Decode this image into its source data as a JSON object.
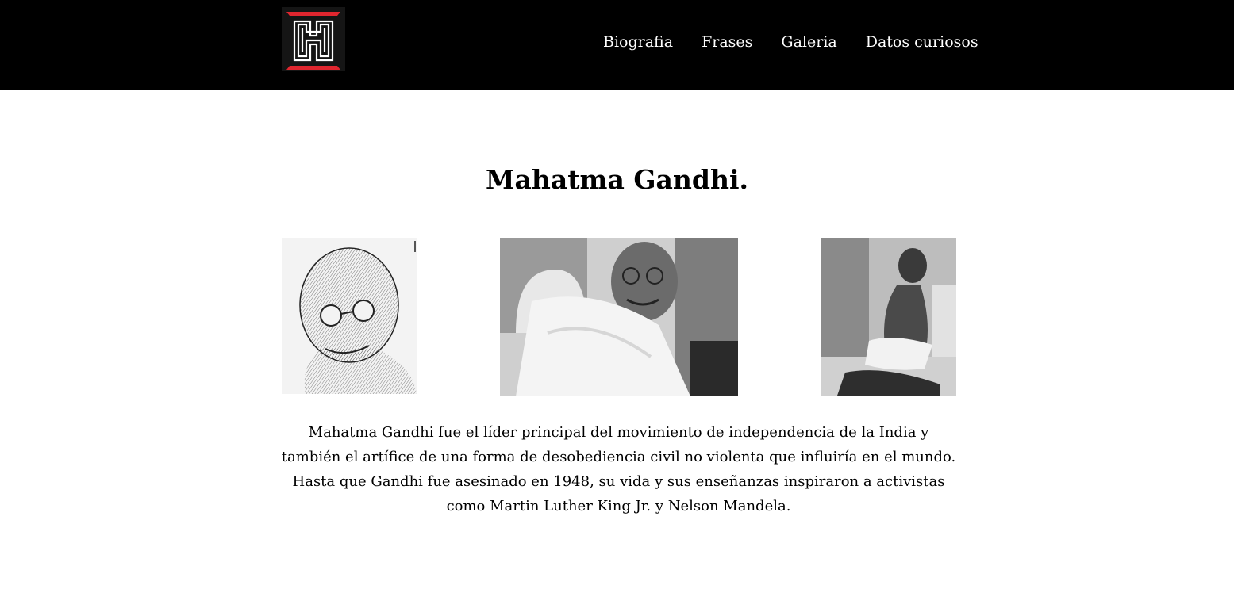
{
  "nav": {
    "logo_icon": "hj-monogram-logo-icon",
    "links": [
      "Biografia",
      "Frases",
      "Galeria",
      "Datos curiosos"
    ]
  },
  "main": {
    "title": "Mahatma Gandhi.",
    "photos": [
      "gandhi-engraving-photo",
      "gandhi-smiling-photo",
      "gandhi-seated-photo"
    ],
    "description": "Mahatma Gandhi fue el líder principal del movimiento de independencia de la India y también el artífice de una forma de desobediencia civil no violenta que influiría en el mundo. Hasta que Gandhi fue asesinado en 1948, su vida y sus enseñanzas inspiraron a activistas como Martin Luther King Jr. y Nelson Mandela."
  },
  "colors": {
    "navbar": "#000000",
    "logo_accent": "#e0262f",
    "text": "#000000",
    "background": "#ffffff"
  }
}
